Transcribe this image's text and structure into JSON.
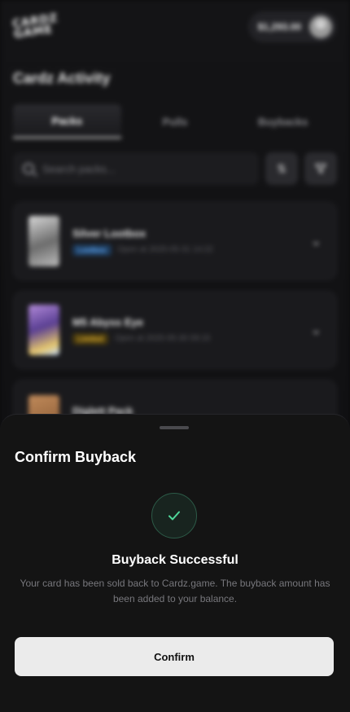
{
  "header": {
    "logo": "CARDZ GAME",
    "balance": "$1,293.00"
  },
  "page": {
    "title": "Cardz Activity"
  },
  "tabs": [
    {
      "label": "Packs",
      "active": true
    },
    {
      "label": "Pulls",
      "active": false
    },
    {
      "label": "Buybacks",
      "active": false
    }
  ],
  "search": {
    "placeholder": "Search packs..."
  },
  "packs": [
    {
      "name": "Silver Lootbox",
      "badge": "Lootbox",
      "opened": "Open at 2025-05-31 14:22"
    },
    {
      "name": "M5 Abyss Eye",
      "badge": "Limited",
      "opened": "Open at 2025-05-30 09:15"
    },
    {
      "name": "Diglett Pack",
      "badge": "",
      "opened": ""
    }
  ],
  "sheet": {
    "title": "Confirm Buyback",
    "success_title": "Buyback Successful",
    "success_description": "Your card has been sold back to Cardz.game. The buyback amount has been added to your balance.",
    "confirm_label": "Confirm"
  },
  "colors": {
    "success_green": "#4fd79a",
    "badge_lootbox": "#66b0ff",
    "badge_limited": "#e7b634"
  },
  "icons": {
    "search": "search-icon",
    "sort": "sort-icon",
    "filter": "filter-icon",
    "expand": "chevron-down-icon",
    "success": "check-icon"
  }
}
